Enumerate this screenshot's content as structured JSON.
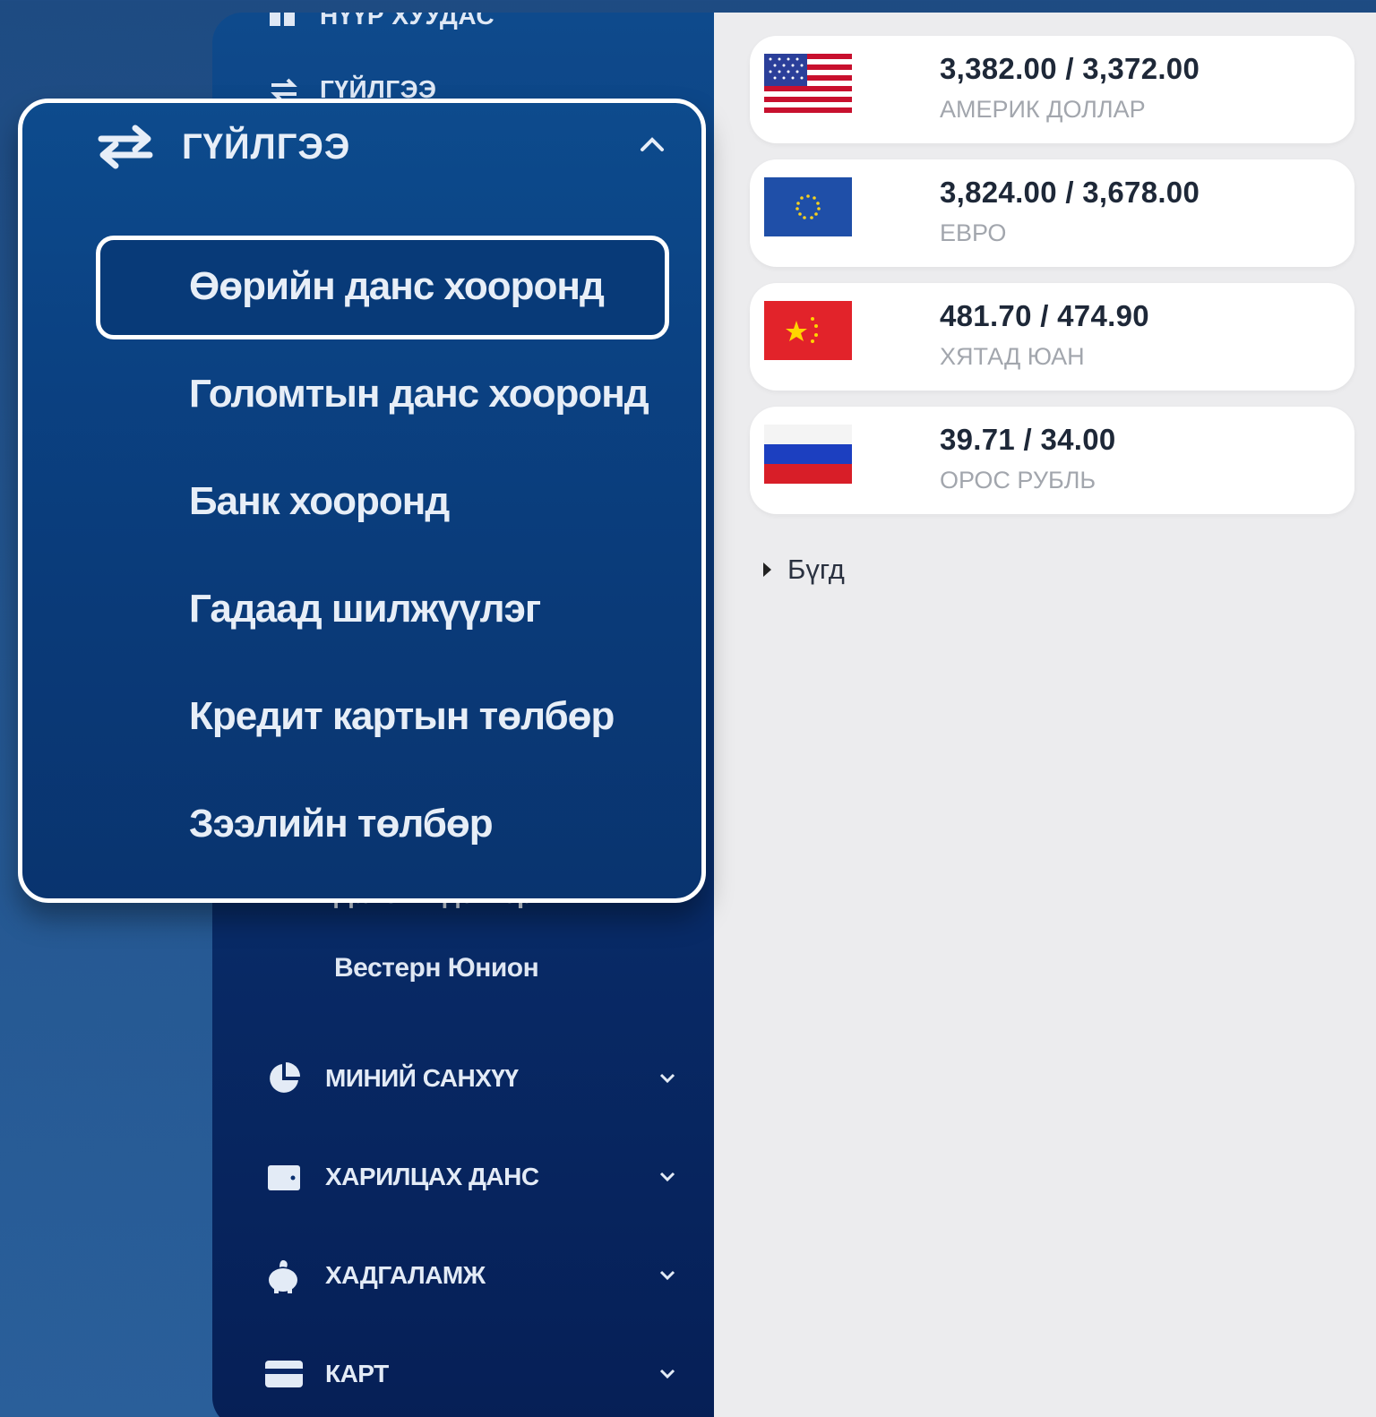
{
  "sidebar": {
    "top_item_partial": "НҮҮР ХУУДАС",
    "transfer_item": "ГҮЙЛГЭЭ",
    "sub_partial": "Дансны дэвтэр",
    "sub_western_union": "Вестерн Юнион",
    "items": [
      {
        "label": "МИНИЙ САНХҮҮ",
        "icon": "pie-chart-icon"
      },
      {
        "label": "ХАРИЛЦАХ ДАНС",
        "icon": "wallet-icon"
      },
      {
        "label": "ХАДГАЛАМЖ",
        "icon": "piggy-bank-icon"
      },
      {
        "label": "КАРТ",
        "icon": "card-icon"
      }
    ]
  },
  "zoom": {
    "header": "ГҮЙЛГЭЭ",
    "items": [
      "Өөрийн данс хооронд",
      "Голомтын данс хооронд",
      "Банк хооронд",
      "Гадаад шилжүүлэг",
      "Кредит картын төлбөр",
      "Зээлийн төлбөр"
    ],
    "selected_index": 0
  },
  "rates": [
    {
      "rate": "3,382.00 / 3,372.00",
      "name": "АМЕРИК ДОЛЛАР",
      "flag": "us-flag-icon"
    },
    {
      "rate": "3,824.00 / 3,678.00",
      "name": "ЕВРО",
      "flag": "eu-flag-icon"
    },
    {
      "rate": "481.70 / 474.90",
      "name": "ХЯТАД ЮАН",
      "flag": "china-flag-icon"
    },
    {
      "rate": "39.71 / 34.00",
      "name": "ОРОС РУБЛЬ",
      "flag": "russia-flag-icon"
    }
  ],
  "all_link": "Бүгд",
  "colors": {
    "page_bg": "#23558f",
    "sidebar_bg": "#0a3a7a",
    "content_bg": "#ececee",
    "rate_text": "#1e2838",
    "currency_text": "#a2a6ad"
  }
}
